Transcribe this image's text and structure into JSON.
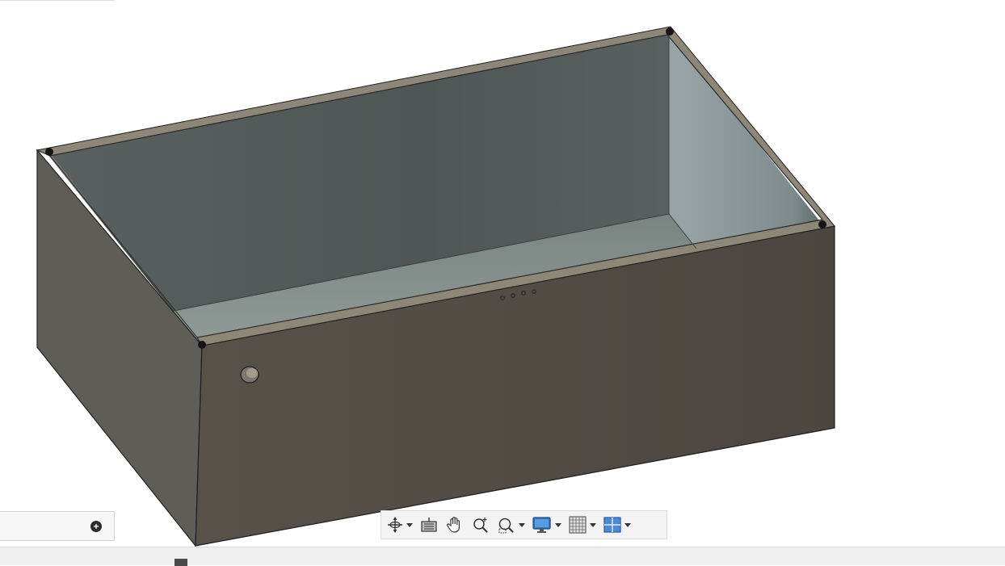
{
  "viewport": {
    "background": "#ffffff",
    "model": "open-top-box",
    "colors": {
      "outer_left_face": "#5e5c57",
      "outer_front_face": "#4f4b45",
      "inner_back_wall": "#555b5a",
      "inner_right_wall": "#7c8788",
      "inner_floor": "#7f8a87",
      "rim": "#8a8475",
      "edge": "#1f1f1f"
    }
  },
  "comments_panel": {
    "add_icon": "plus-circle-icon"
  },
  "navigation_toolbar": {
    "buttons": [
      {
        "name": "orbit",
        "icon": "orbit-icon",
        "has_dropdown": true
      },
      {
        "name": "look-at",
        "icon": "look-at-icon",
        "has_dropdown": false
      },
      {
        "name": "pan",
        "icon": "hand-icon",
        "has_dropdown": false
      },
      {
        "name": "zoom",
        "icon": "zoom-icon",
        "has_dropdown": false
      },
      {
        "name": "fit",
        "icon": "zoom-window-icon",
        "has_dropdown": true
      },
      {
        "name": "display-settings",
        "icon": "monitor-icon",
        "has_dropdown": true
      },
      {
        "name": "grid-snaps",
        "icon": "grid-icon",
        "has_dropdown": true
      },
      {
        "name": "viewports",
        "icon": "viewports-icon",
        "has_dropdown": true
      }
    ]
  },
  "timeline": {
    "marker_icon": "timeline-marker-icon"
  }
}
